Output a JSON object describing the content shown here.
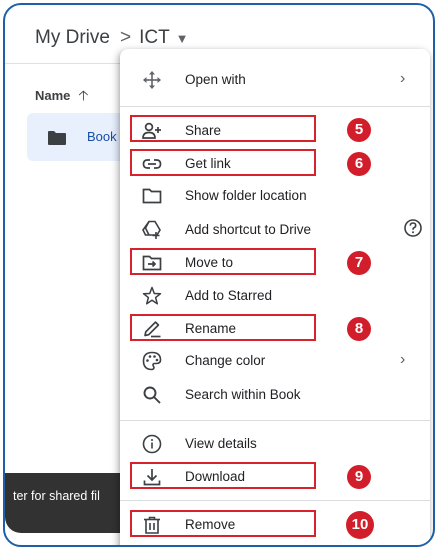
{
  "breadcrumb": {
    "root": "My Drive",
    "separator": ">",
    "current": "ICT"
  },
  "file_list": {
    "column_header": "Name",
    "sort_direction": "ascending",
    "selected_item": "Book"
  },
  "snackbar": {
    "text": "ter for shared fil"
  },
  "menu": {
    "items": [
      {
        "label": "Open with",
        "icon": "open-with-icon",
        "submenu": true
      },
      {
        "label": "Share",
        "icon": "share-person-add-icon",
        "marker": "5"
      },
      {
        "label": "Get link",
        "icon": "link-icon",
        "marker": "6"
      },
      {
        "label": "Show folder location",
        "icon": "folder-outline-icon"
      },
      {
        "label": "Add shortcut to Drive",
        "icon": "add-shortcut-icon",
        "help": true
      },
      {
        "label": "Move to",
        "icon": "move-to-folder-icon",
        "marker": "7"
      },
      {
        "label": "Add to Starred",
        "icon": "star-icon"
      },
      {
        "label": "Rename",
        "icon": "pencil-icon",
        "marker": "8"
      },
      {
        "label": "Change color",
        "icon": "palette-icon",
        "submenu": true
      },
      {
        "label": "Search within Book",
        "icon": "search-icon"
      },
      {
        "label": "View details",
        "icon": "info-icon"
      },
      {
        "label": "Download",
        "icon": "download-icon",
        "marker": "9"
      },
      {
        "label": "Remove",
        "icon": "trash-icon",
        "marker": "10"
      }
    ]
  },
  "colors": {
    "frame": "#1f5fa8",
    "highlight_box": "#d6222d",
    "marker_fill": "#d21e2a",
    "selected_row": "#e8f0fe"
  }
}
